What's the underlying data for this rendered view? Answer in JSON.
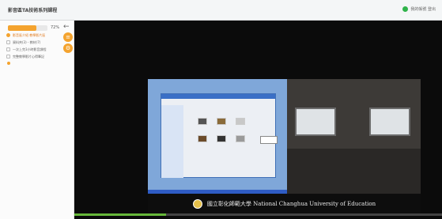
{
  "header": {
    "title": "影音區TA技術系列課程",
    "user_label": "我的帳號 登出"
  },
  "sidebar": {
    "progress_percent": 72,
    "progress_text": "72%",
    "items": [
      {
        "label": "影音區介紹 教學影片區",
        "active": true
      },
      {
        "label": "資料夾(3) - 教材(7)",
        "active": false
      },
      {
        "label": "一次上完3小時影音課程",
        "active": false
      },
      {
        "label": "完整教學影片心得筆記",
        "active": false
      }
    ]
  },
  "video": {
    "caption": "國立彰化師範大學 National Changhua University of Education",
    "playback_fraction": 0.25
  },
  "colors": {
    "accent": "#f4a32e",
    "online": "#2fb34a",
    "playback": "#67b83a"
  }
}
